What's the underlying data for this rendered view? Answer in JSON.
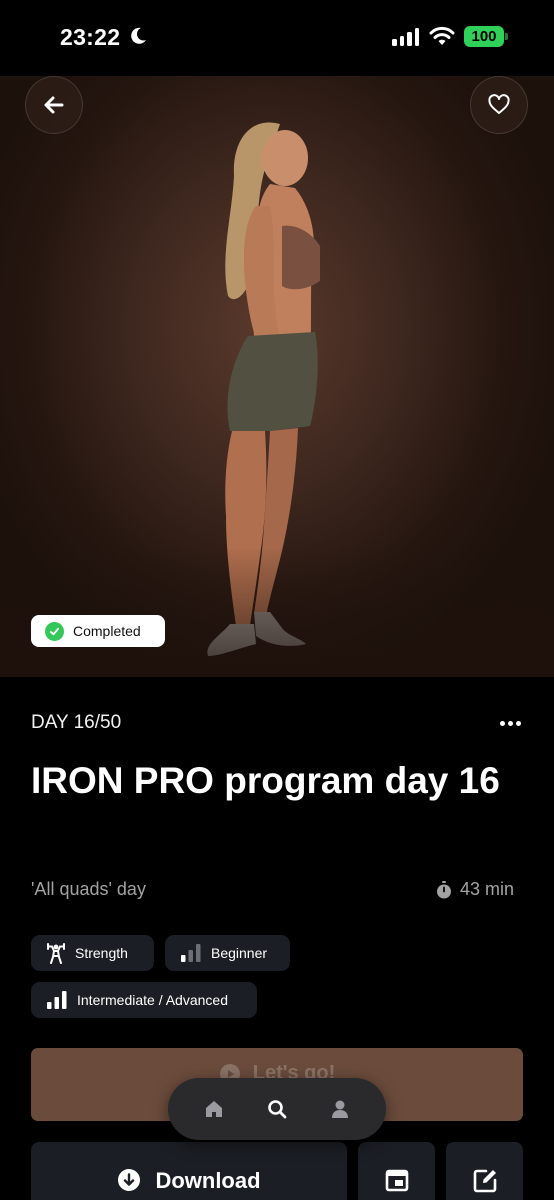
{
  "status_bar": {
    "time": "23:22",
    "battery": "100"
  },
  "hero": {
    "badge_label": "Completed"
  },
  "workout": {
    "day_label": "DAY 16/50",
    "title": "IRON PRO program day 16",
    "subtitle": "'All quads' day",
    "duration": "43 min",
    "tags": [
      {
        "label": "Strength",
        "icon": "strength-figure-icon"
      },
      {
        "label": "Beginner",
        "icon": "level-bars-icon"
      },
      {
        "label": "Intermediate / Advanced",
        "icon": "level-bars-icon"
      }
    ]
  },
  "actions": {
    "start_label": "Let's go!",
    "download_label": "Download"
  },
  "bottom_nav": {
    "items": [
      "home-icon",
      "search-icon",
      "profile-icon"
    ]
  },
  "colors": {
    "accent_brown": "#6b4c3c",
    "completed_green": "#34c759",
    "battery_green": "#30d158",
    "surface": "#1b1e24"
  }
}
